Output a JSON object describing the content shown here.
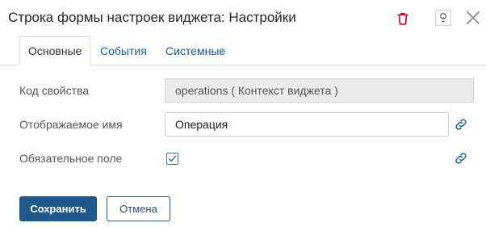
{
  "header": {
    "title": "Строка формы настроек виджета: Настройки",
    "icons": {
      "delete": "trash-icon",
      "help": "help-icon",
      "close": "close-icon"
    },
    "colors": {
      "delete_icon": "#d0021b"
    }
  },
  "tabs": [
    {
      "label": "Основные",
      "active": true
    },
    {
      "label": "События",
      "active": false
    },
    {
      "label": "Системные",
      "active": false
    }
  ],
  "form": {
    "property_code": {
      "label": "Код свойства",
      "value": "operations ( Контекст виджета )",
      "readonly": true
    },
    "display_name": {
      "label": "Отображаемое имя",
      "value": "Операция"
    },
    "required": {
      "label": "Обязательное поле",
      "checked": true
    }
  },
  "buttons": {
    "save": "Сохранить",
    "cancel": "Отмена"
  },
  "colors": {
    "accent": "#20598e",
    "link": "#1a5c99"
  }
}
